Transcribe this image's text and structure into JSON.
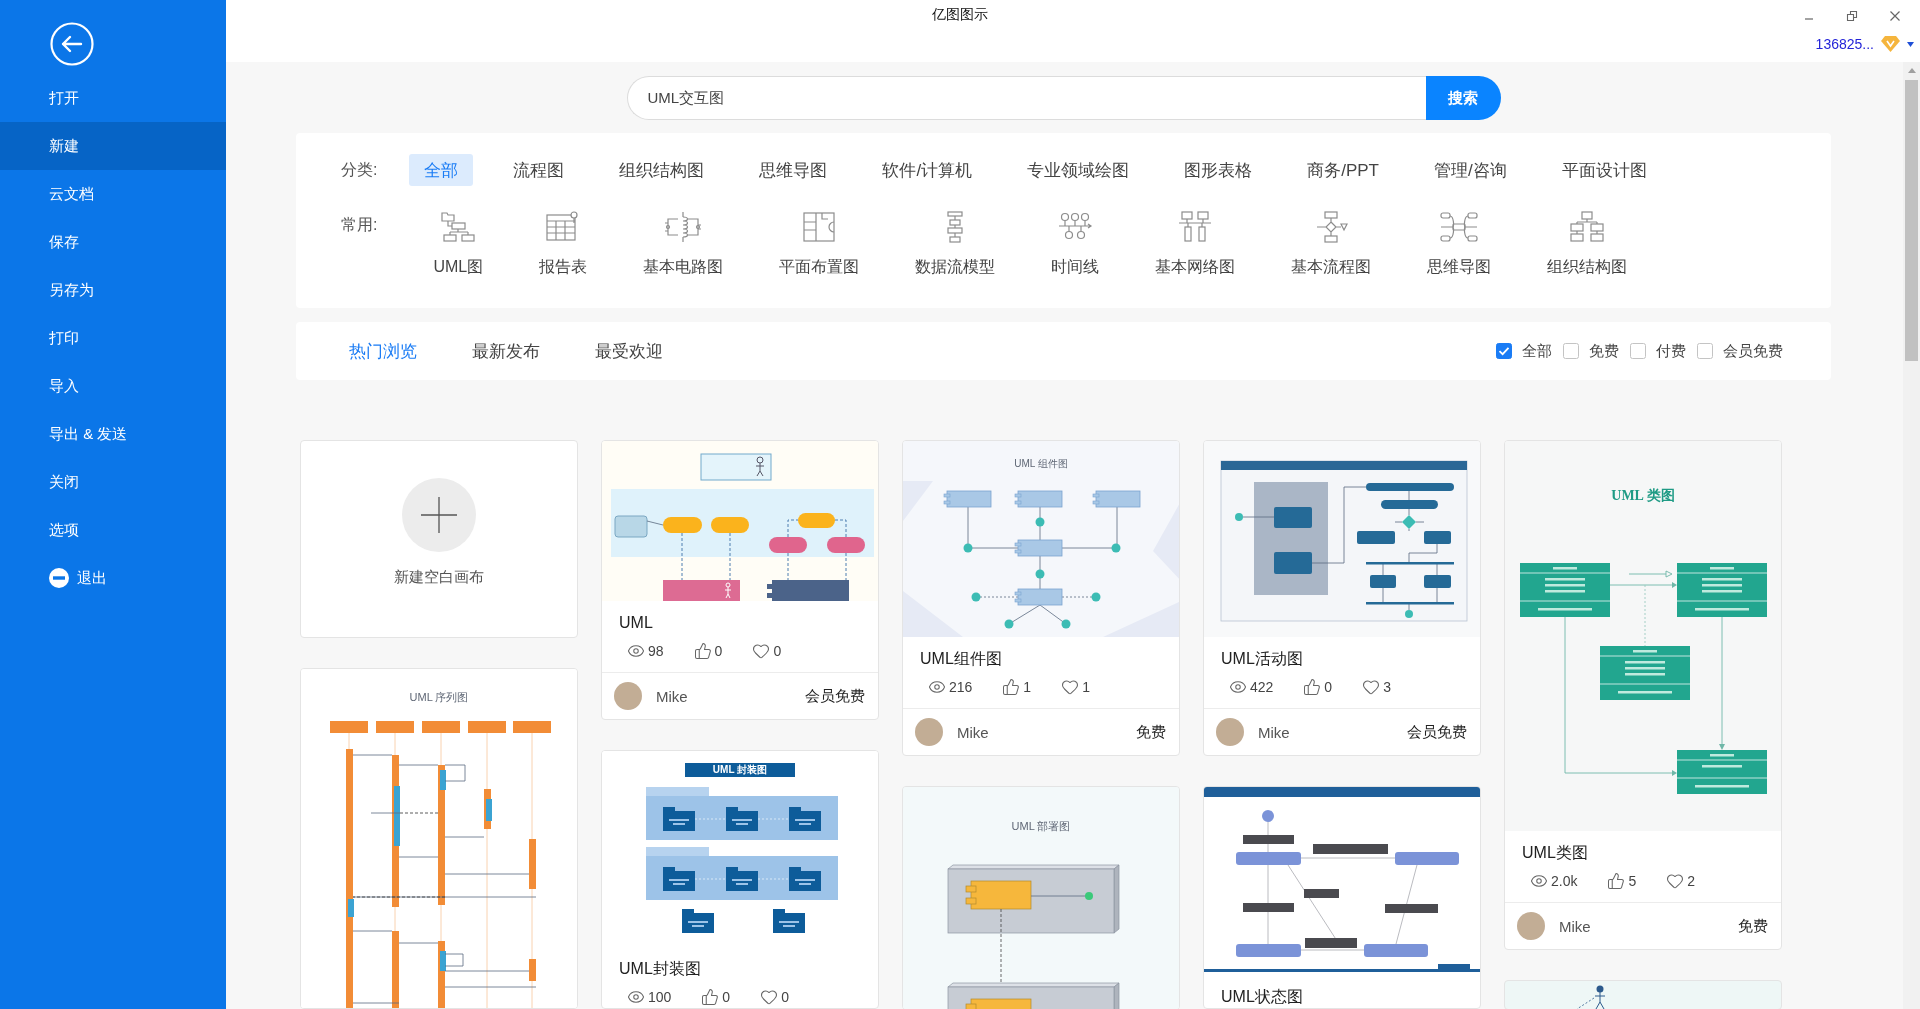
{
  "window": {
    "title": "亿图图示",
    "account": "136825..."
  },
  "sidebar": {
    "items": [
      {
        "label": "打开",
        "kind": "plain",
        "selected": false
      },
      {
        "label": "新建",
        "kind": "plain",
        "selected": true
      },
      {
        "label": "云文档",
        "kind": "plain",
        "selected": false
      },
      {
        "label": "保存",
        "kind": "plain",
        "selected": false
      },
      {
        "label": "另存为",
        "kind": "plain",
        "selected": false
      },
      {
        "label": "打印",
        "kind": "plain",
        "selected": false
      },
      {
        "label": "导入",
        "kind": "plain",
        "selected": false
      },
      {
        "label": "导出 & 发送",
        "kind": "plain",
        "selected": false
      },
      {
        "label": "关闭",
        "kind": "plain",
        "selected": false
      },
      {
        "label": "选项",
        "kind": "plain",
        "selected": false
      },
      {
        "label": "退出",
        "kind": "exit",
        "selected": false
      }
    ]
  },
  "search": {
    "value": "UML交互图",
    "button": "搜索"
  },
  "categories": {
    "label": "分类:",
    "items": [
      {
        "label": "全部",
        "selected": true
      },
      {
        "label": "流程图",
        "selected": false
      },
      {
        "label": "组织结构图",
        "selected": false
      },
      {
        "label": "思维导图",
        "selected": false
      },
      {
        "label": "软件/计算机",
        "selected": false
      },
      {
        "label": "专业领域绘图",
        "selected": false
      },
      {
        "label": "图形表格",
        "selected": false
      },
      {
        "label": "商务/PPT",
        "selected": false
      },
      {
        "label": "管理/咨询",
        "selected": false
      },
      {
        "label": "平面设计图",
        "selected": false
      }
    ]
  },
  "common_types": {
    "label": "常用:",
    "items": [
      {
        "label": "UML图"
      },
      {
        "label": "报告表"
      },
      {
        "label": "基本电路图"
      },
      {
        "label": "平面布置图"
      },
      {
        "label": "数据流模型"
      },
      {
        "label": "时间线"
      },
      {
        "label": "基本网络图"
      },
      {
        "label": "基本流程图"
      },
      {
        "label": "思维导图"
      },
      {
        "label": "组织结构图"
      }
    ]
  },
  "browse_tabs": [
    {
      "label": "热门浏览",
      "selected": true
    },
    {
      "label": "最新发布",
      "selected": false
    },
    {
      "label": "最受欢迎",
      "selected": false
    }
  ],
  "filters": [
    {
      "label": "全部",
      "checked": true
    },
    {
      "label": "免费",
      "checked": false
    },
    {
      "label": "付费",
      "checked": false
    },
    {
      "label": "会员免费",
      "checked": false
    }
  ],
  "card_columns": [
    {
      "cards": [
        {
          "kind": "new",
          "label": "新建空白画布"
        },
        {
          "kind": "template",
          "preview": {
            "kind": "sequence",
            "title": "UML 序列图"
          }
        }
      ]
    },
    {
      "cards": [
        {
          "kind": "template",
          "preview": {
            "kind": "use-case"
          },
          "title": "UML",
          "views": "98",
          "likes": "0",
          "favorites": "0",
          "author": "Mike",
          "price": "会员免费"
        },
        {
          "kind": "template",
          "preview": {
            "kind": "package",
            "title": "UML 封装图"
          },
          "title": "UML封装图",
          "views": "100",
          "likes": "0",
          "favorites": "0"
        }
      ]
    },
    {
      "cards": [
        {
          "kind": "template",
          "preview": {
            "kind": "component",
            "title": "UML 组件图"
          },
          "title": "UML组件图",
          "views": "216",
          "likes": "1",
          "favorites": "1",
          "author": "Mike",
          "price": "免费"
        },
        {
          "kind": "template",
          "preview": {
            "kind": "deployment",
            "title": "UML 部署图"
          }
        }
      ]
    },
    {
      "cards": [
        {
          "kind": "template",
          "preview": {
            "kind": "activity"
          },
          "title": "UML活动图",
          "views": "422",
          "likes": "0",
          "favorites": "3",
          "author": "Mike",
          "price": "会员免费"
        },
        {
          "kind": "template",
          "preview": {
            "kind": "state"
          },
          "title": "UML状态图"
        }
      ]
    },
    {
      "cards": [
        {
          "kind": "template",
          "preview": {
            "kind": "class",
            "title": "UML 类图"
          },
          "title": "UML类图",
          "views": "2.0k",
          "likes": "5",
          "favorites": "2",
          "author": "Mike",
          "price": "免费"
        },
        {
          "kind": "template",
          "preview": {
            "kind": "actor"
          }
        }
      ]
    }
  ]
}
